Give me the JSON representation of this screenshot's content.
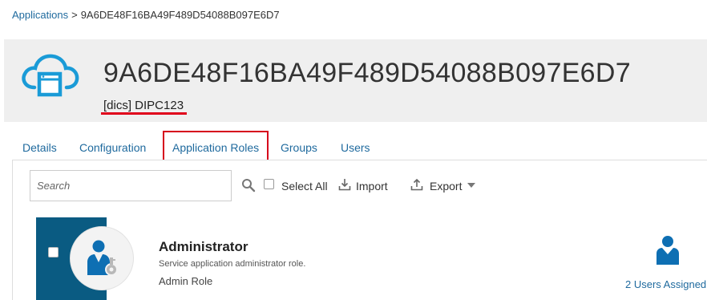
{
  "breadcrumb": {
    "root": "Applications",
    "separator": ">",
    "current": "9A6DE48F16BA49F489D54088B097E6D7"
  },
  "header": {
    "title": "9A6DE48F16BA49F489D54088B097E6D7",
    "subtitle": "[dics] DIPC123",
    "icon": "cloud-window-icon"
  },
  "tabs": [
    {
      "label": "Details"
    },
    {
      "label": "Configuration"
    },
    {
      "label": "Application Roles",
      "active": true
    },
    {
      "label": "Groups"
    },
    {
      "label": "Users"
    }
  ],
  "toolbar": {
    "search_placeholder": "Search",
    "select_all_label": "Select All",
    "import_label": "Import",
    "export_label": "Export"
  },
  "roles": [
    {
      "name": "Administrator",
      "description": "Service application administrator role.",
      "type": "Admin Role",
      "users_assigned": "2 Users Assigned"
    }
  ],
  "colors": {
    "link": "#1f6a9e",
    "accent_strip": "#0a5b82",
    "highlight_red": "#d6001c",
    "header_band": "#efefef",
    "icon_blue": "#0e6fb3"
  }
}
